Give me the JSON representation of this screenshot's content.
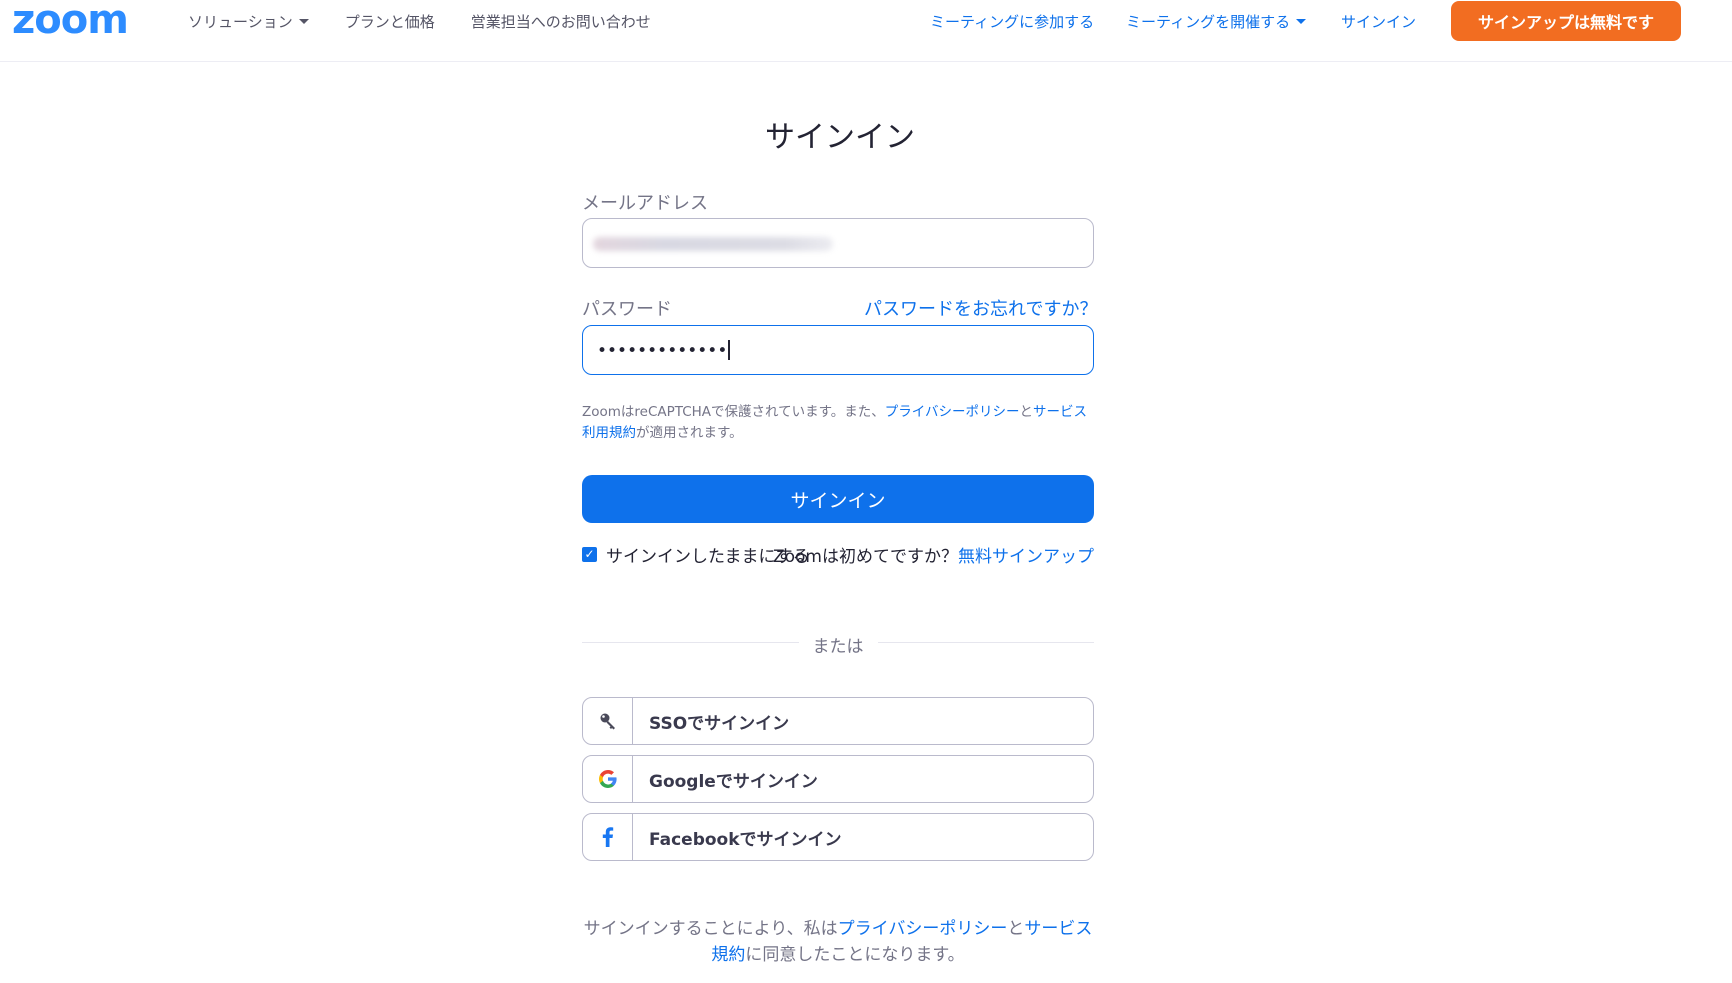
{
  "header": {
    "logo": "zoom",
    "nav_left": [
      {
        "label": "ソリューション",
        "dropdown": true
      },
      {
        "label": "プランと価格",
        "dropdown": false
      },
      {
        "label": "営業担当へのお問い合わせ",
        "dropdown": false
      }
    ],
    "join_meeting": "ミーティングに参加する",
    "host_meeting": "ミーティングを開催する",
    "sign_in": "サインイン",
    "sign_up": "サインアップは無料です"
  },
  "form": {
    "title": "サインイン",
    "email_label": "メールアドレス",
    "password_label": "パスワード",
    "forgot_password": "パスワードをお忘れですか？",
    "password_value": "•••••••••••••",
    "recaptcha_prefix": "ZoomはreCAPTCHAで保護されています。また、",
    "privacy_policy": "プライバシーポリシー",
    "and": "と",
    "terms": "サービス利用規約",
    "recaptcha_suffix": "が適用されます。",
    "sign_in_button": "サインイン",
    "keep_signed_in": "サインインしたままにする",
    "keep_signed_in_checked": true,
    "new_to_zoom": "Zoomは初めてですか？",
    "free_signup": "無料サインアップ",
    "or": "または"
  },
  "sso_buttons": [
    {
      "label": "SSOでサインイン",
      "icon": "key-icon"
    },
    {
      "label": "Googleでサインイン",
      "icon": "google-icon"
    },
    {
      "label": "Facebookでサインイン",
      "icon": "facebook-icon"
    }
  ],
  "footer": {
    "prefix": "サインインすることにより、私は",
    "privacy_policy": "プライバシーポリシー",
    "and": "と",
    "terms": "サービス規約",
    "suffix": "に同意したことになります。"
  },
  "colors": {
    "brand_blue": "#0e71eb",
    "logo_blue": "#2d8cff",
    "signup_orange": "#f26d21"
  }
}
